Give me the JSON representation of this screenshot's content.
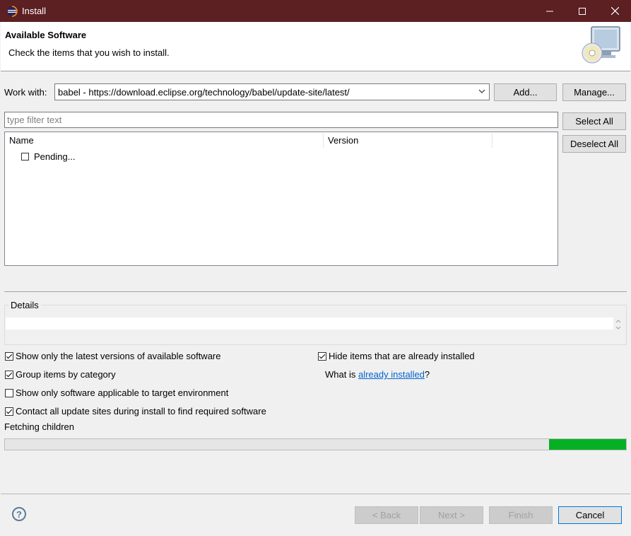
{
  "window": {
    "title": "Install"
  },
  "header": {
    "title": "Available Software",
    "description": "Check the items that you wish to install."
  },
  "work_with": {
    "label": "Work with:",
    "value": "babel - https://download.eclipse.org/technology/babel/update-site/latest/",
    "add_label": "Add...",
    "manage_label": "Manage..."
  },
  "filter": {
    "placeholder": "type filter text"
  },
  "selection_buttons": {
    "select_all": "Select All",
    "deselect_all": "Deselect All"
  },
  "table": {
    "columns": [
      "Name",
      "Version"
    ],
    "rows": [
      {
        "name": "Pending...",
        "checked": false
      }
    ]
  },
  "details": {
    "label": "Details"
  },
  "options": {
    "show_latest": {
      "label": "Show only the latest versions of available software",
      "checked": true
    },
    "group_by_category": {
      "label": "Group items by category",
      "checked": true
    },
    "show_applicable": {
      "label": "Show only software applicable to target environment",
      "checked": false
    },
    "contact_all": {
      "label": "Contact all update sites during install to find required software",
      "checked": true
    },
    "hide_installed": {
      "label": "Hide items that are already installed",
      "checked": true
    },
    "what_is_prefix": "What is ",
    "already_installed_link": "already installed",
    "what_is_suffix": "?"
  },
  "status": {
    "text": "Fetching children",
    "progress_fraction_start": 0.876,
    "progress_fraction_end": 1.0
  },
  "footer": {
    "back_label": "< Back",
    "next_label": "Next >",
    "finish_label": "Finish",
    "cancel_label": "Cancel"
  },
  "colors": {
    "titlebar": "#5c1f22",
    "progress": "#06b025",
    "link": "#0066cc"
  }
}
